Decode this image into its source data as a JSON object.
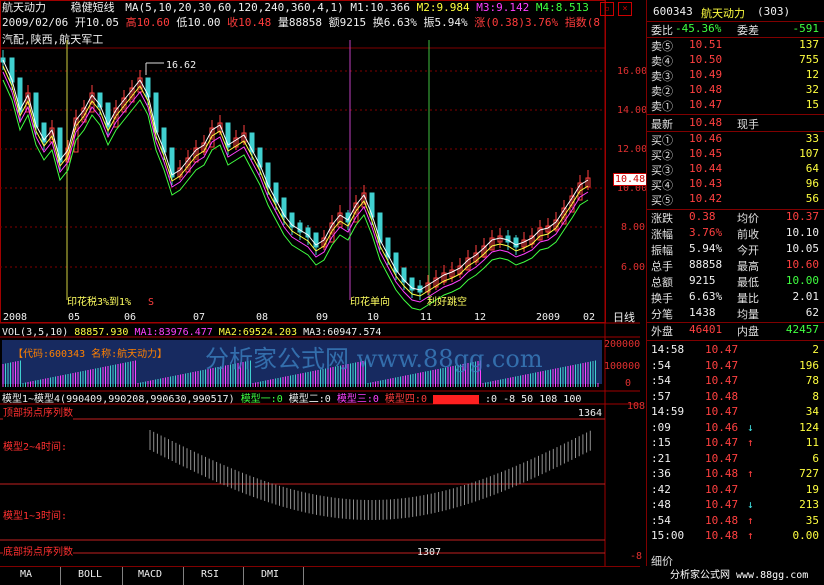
{
  "header": {
    "stock_name": "航天动力",
    "indicator_name": "稳健短线",
    "ma_params": "MA(5,10,20,30,60,120,240,360,4,1)",
    "m1": "M1:10.366",
    "m2": "M2:9.984",
    "m3": "M3:9.142",
    "m4": "M4:8.513",
    "date": "2009/02/06",
    "open": "开10.05",
    "high": "高10.60",
    "low": "低10.00",
    "close": "收10.48",
    "volume": "量88858",
    "amount": "额9215",
    "turnover": "换6.63%",
    "amplitude": "振5.94%",
    "change": "涨(0.38)3.76%",
    "index_label": "指数(8",
    "tags": "汽配,陕西,航天军工"
  },
  "price_chart": {
    "y_labels": [
      "16.00",
      "14.00",
      "12.00",
      "10.00",
      "8.00",
      "6.00"
    ],
    "high_marker": "16.62",
    "current_price": "10.48",
    "x_labels": [
      "2008",
      "05",
      "06",
      "07",
      "08",
      "09",
      "10",
      "11",
      "12",
      "2009",
      "02"
    ],
    "period_label": "日线",
    "annotations": [
      "印花税3%到1%",
      "印花单向",
      "利好跳空"
    ],
    "s_marker": "S"
  },
  "volume_chart": {
    "title": "VOL(3,5,10)",
    "vol_value": "88857.930",
    "ma1": "MA1:83976.477",
    "ma2": "MA2:69524.203",
    "ma3": "MA3:60947.574",
    "info_box": "【代码:600343 名称:航天动力】",
    "y_labels": [
      "200000",
      "100000",
      "0"
    ],
    "watermark": "分析家公式网 www.88gg.com"
  },
  "model_chart": {
    "title": "模型1~模型4(990409,990208,990630,990517)",
    "m_one": "模型一:0",
    "m_two": "模型二:0",
    "m_three": "模型三:0",
    "m_four": "模型四:0",
    "tail": ":0 -8 50 108 100",
    "labels": [
      "顶部拐点序列数",
      "模型2~4时间:",
      "模型1~3时间:",
      "底部拐点序列数"
    ],
    "value_top": "1364",
    "value_bottom": "1307",
    "y_top": "108",
    "y_bottom": "-8"
  },
  "tabs": [
    "MA",
    "BOLL",
    "MACD",
    "RSI",
    "DMI"
  ],
  "right_panel": {
    "code": "600343",
    "name": "航天动力",
    "num": "(303)",
    "weibi_label": "委比",
    "weibi_value": "-45.36%",
    "weicha_label": "委差",
    "weicha_value": "-591",
    "asks": [
      {
        "label": "卖⑤",
        "price": "10.51",
        "vol": "137"
      },
      {
        "label": "卖④",
        "price": "10.50",
        "vol": "755"
      },
      {
        "label": "卖③",
        "price": "10.49",
        "vol": "12"
      },
      {
        "label": "卖②",
        "price": "10.48",
        "vol": "32"
      },
      {
        "label": "卖①",
        "price": "10.47",
        "vol": "15"
      }
    ],
    "latest_label": "最新",
    "latest_value": "10.48",
    "now_hand_label": "现手",
    "bids": [
      {
        "label": "买①",
        "price": "10.46",
        "vol": "33"
      },
      {
        "label": "买②",
        "price": "10.45",
        "vol": "107"
      },
      {
        "label": "买③",
        "price": "10.44",
        "vol": "64"
      },
      {
        "label": "买④",
        "price": "10.43",
        "vol": "96"
      },
      {
        "label": "买⑤",
        "price": "10.42",
        "vol": "56"
      }
    ],
    "stats": [
      {
        "l1": "涨跌",
        "v1": "0.38",
        "l2": "均价",
        "v2": "10.37"
      },
      {
        "l1": "涨幅",
        "v1": "3.76%",
        "l2": "前收",
        "v2": "10.10"
      },
      {
        "l1": "振幅",
        "v1": "5.94%",
        "l2": "今开",
        "v2": "10.05"
      },
      {
        "l1": "总手",
        "v1": "88858",
        "l2": "最高",
        "v2": "10.60"
      },
      {
        "l1": "总额",
        "v1": "9215",
        "l2": "最低",
        "v2": "10.00"
      },
      {
        "l1": "换手",
        "v1": "6.63%",
        "l2": "量比",
        "v2": "2.01"
      },
      {
        "l1": "分笔",
        "v1": "1438",
        "l2": "均量",
        "v2": "62"
      }
    ],
    "outer_label": "外盘",
    "outer_value": "46401",
    "inner_label": "内盘",
    "inner_value": "42457",
    "ticks": [
      {
        "time": "14:58",
        "price": "10.47",
        "arrow": "",
        "vol": "2"
      },
      {
        "time": ":54",
        "price": "10.47",
        "arrow": "",
        "vol": "196"
      },
      {
        "time": ":54",
        "price": "10.47",
        "arrow": "",
        "vol": "78"
      },
      {
        "time": ":57",
        "price": "10.48",
        "arrow": "",
        "vol": "8"
      },
      {
        "time": "14:59",
        "price": "10.47",
        "arrow": "",
        "vol": "34"
      },
      {
        "time": ":09",
        "price": "10.46",
        "arrow": "↓",
        "vol": "124"
      },
      {
        "time": ":15",
        "price": "10.47",
        "arrow": "↑",
        "vol": "11"
      },
      {
        "time": ":21",
        "price": "10.47",
        "arrow": "",
        "vol": "6"
      },
      {
        "time": ":36",
        "price": "10.48",
        "arrow": "↑",
        "vol": "727"
      },
      {
        "time": ":42",
        "price": "10.47",
        "arrow": "",
        "vol": "19"
      },
      {
        "time": ":48",
        "price": "10.47",
        "arrow": "↓",
        "vol": "213"
      },
      {
        "time": ":54",
        "price": "10.48",
        "arrow": "↑",
        "vol": "35"
      },
      {
        "time": "15:00",
        "price": "10.48",
        "arrow": "↑",
        "vol": "0.00"
      }
    ],
    "footer_label": "细价",
    "brand": "分析家公式网 www.88gg.com"
  }
}
